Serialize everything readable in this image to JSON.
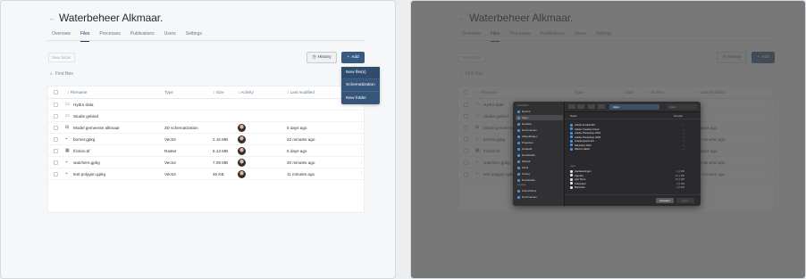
{
  "app": {
    "title": "Waterbeheer Alkmaar.",
    "back_icon": "arrow-left-icon",
    "tabs": [
      "Overview",
      "Files",
      "Processes",
      "Publications",
      "Users",
      "Settings"
    ],
    "active_tab": "Files",
    "toolbar": {
      "new_folder": "New folder",
      "history": "History",
      "add": "Add"
    },
    "search": {
      "placeholder": "Find files"
    },
    "add_menu": [
      "New file(s)",
      "Schematization",
      "New folder"
    ],
    "table": {
      "columns": [
        "Filename",
        "Type",
        "Size",
        "Activity",
        "Last modified"
      ],
      "rows": [
        {
          "icon": "folder-icon",
          "name": "Hydro data",
          "type": "",
          "size": "",
          "avatar": false,
          "modified": ""
        },
        {
          "icon": "folder-icon",
          "name": "Studie gebied",
          "type": "",
          "size": "",
          "avatar": false,
          "modified": ""
        },
        {
          "icon": "model-icon",
          "name": "Model gemeente alkmaar",
          "type": "2D schematization",
          "size": "",
          "avatar": true,
          "modified": "5 days ago"
        },
        {
          "icon": "vector-icon",
          "name": "borner.gpkg",
          "type": "Vector",
          "size": "2.15 MB",
          "avatar": true,
          "modified": "22 minutes ago"
        },
        {
          "icon": "raster-icon",
          "name": "friction.tif",
          "type": "Raster",
          "size": "5.13 MB",
          "avatar": true,
          "modified": "5 days ago"
        },
        {
          "icon": "vector-icon",
          "name": "watchers.gpkg",
          "type": "Vector",
          "size": "7.09 MB",
          "avatar": true,
          "modified": "20 minutes ago"
        },
        {
          "icon": "vector-icon",
          "name": "test polygon.gpkg",
          "type": "Vector",
          "size": "46 KB",
          "avatar": true,
          "modified": "11 minutes ago"
        }
      ]
    }
  },
  "dialog": {
    "sidebar": {
      "favorites_header": "Favorieten",
      "favorites": [
        "Recent",
        "Apps",
        "Desktop",
        "Documenten",
        "Afbeeldingen",
        "Projecten",
        "Gedeeld",
        "Downloads",
        "Muziek",
        "Films",
        "Overig",
        "Downloads"
      ],
      "locations_header": "Locaties",
      "locations": [
        "iCloud Drive",
        "Documenten"
      ]
    },
    "location": "Apps",
    "search_placeholder": "Zoek",
    "columns": [
      "Naam",
      "Grootte"
    ],
    "group_labels": [
      "Apps",
      "Apps"
    ],
    "files": [
      {
        "name": "Adobe Acrobat DC",
        "size": "--"
      },
      {
        "name": "Adobe Creative Cloud",
        "size": "--"
      },
      {
        "name": "Adobe Photoshop 2024",
        "size": "--"
      },
      {
        "name": "Adobe Photoshop 2025",
        "size": "--"
      },
      {
        "name": "Hulpprogramma's",
        "size": "--"
      },
      {
        "name": "Sketchup 2024",
        "size": "--"
      },
      {
        "name": "Wacom tablet",
        "size": "--"
      }
    ],
    "apps": [
      {
        "name": "Aantekeningen",
        "size": "4,4 MB"
      },
      {
        "name": "Agenda",
        "size": "12,1 MB"
      },
      {
        "name": "App Store",
        "size": "18,3 MB"
      },
      {
        "name": "Automator",
        "size": "4,6 MB"
      },
      {
        "name": "Berichten",
        "size": "3,6 MB"
      }
    ],
    "cancel": "Annuleer",
    "open": "Open"
  }
}
